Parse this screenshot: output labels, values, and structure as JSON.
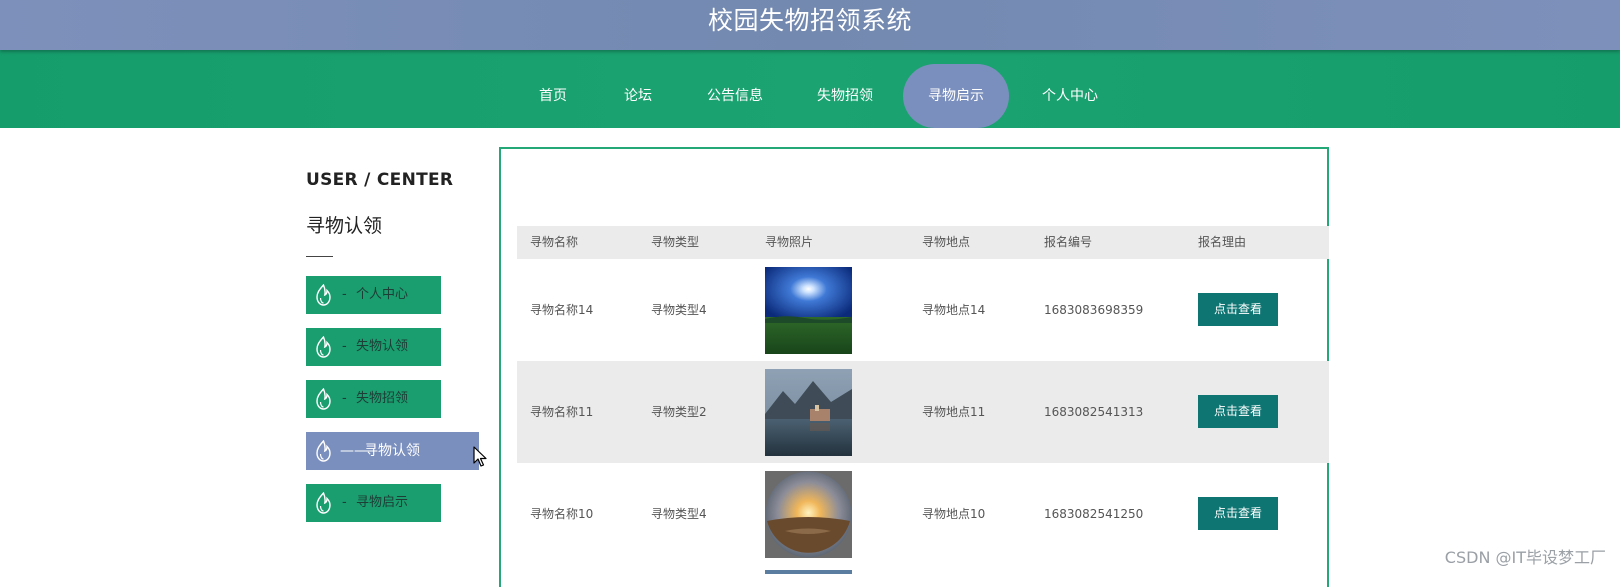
{
  "header": {
    "title": "校园失物招领系统"
  },
  "nav": {
    "items": [
      {
        "label": "首页"
      },
      {
        "label": "论坛"
      },
      {
        "label": "公告信息"
      },
      {
        "label": "失物招领"
      },
      {
        "label": "寻物启示"
      },
      {
        "label": "个人中心"
      }
    ],
    "active_index": 4
  },
  "sidebar": {
    "title": "USER / CENTER",
    "subtitle": "寻物认领",
    "items": [
      {
        "label": "个人中心",
        "dash": "-"
      },
      {
        "label": "失物认领",
        "dash": "-"
      },
      {
        "label": "失物招领",
        "dash": "-"
      },
      {
        "label": "寻物认领",
        "dash": "——"
      },
      {
        "label": "寻物启示",
        "dash": "-"
      }
    ],
    "active_index": 3
  },
  "table": {
    "columns": [
      "寻物名称",
      "寻物类型",
      "寻物照片",
      "寻物地点",
      "报名编号",
      "报名理由"
    ],
    "rows": [
      {
        "name": "寻物名称14",
        "type": "寻物类型4",
        "photo": "moonlit-meadow",
        "place": "寻物地点14",
        "number": "1683083698359",
        "action": "点击查看"
      },
      {
        "name": "寻物名称11",
        "type": "寻物类型2",
        "photo": "mountain-lake-village",
        "place": "寻物地点11",
        "number": "1683082541313",
        "action": "点击查看"
      },
      {
        "name": "寻物名称10",
        "type": "寻物类型4",
        "photo": "desert-sunset-fisheye",
        "place": "寻物地点10",
        "number": "1683082541250",
        "action": "点击查看"
      }
    ]
  },
  "watermark": "CSDN @IT毕设梦工厂",
  "colors": {
    "title_bar": "#7389b0",
    "nav_bar": "#1ba371",
    "active": "#7b8fbe",
    "menu_green": "#1a9e6f",
    "button_teal": "#0e7572",
    "panel_border": "#25a878"
  }
}
